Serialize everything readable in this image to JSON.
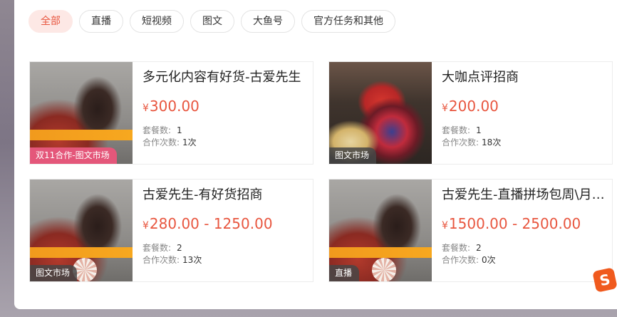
{
  "tabs": [
    {
      "label": "全部",
      "active": true
    },
    {
      "label": "直播"
    },
    {
      "label": "短视频"
    },
    {
      "label": "图文"
    },
    {
      "label": "大鱼号"
    },
    {
      "label": "官方任务和其他"
    }
  ],
  "labels": {
    "currency": "¥",
    "package_count": "套餐数:",
    "coop_count": "合作次数:"
  },
  "cards": [
    {
      "title": "多元化内容有好货-古爱先生",
      "price": "300.00",
      "packages": "1",
      "coops": "1次",
      "badge": "双11合作-图文市场",
      "thumb": "hand-photo"
    },
    {
      "title": "大咖点评招商",
      "price": "200.00",
      "packages": "1",
      "coops": "18次",
      "badge": "图文市场",
      "thumb": "mask-photo"
    },
    {
      "title": "古爱先生-有好货招商",
      "price": "280.00 - 1250.00",
      "packages": "2",
      "coops": "13次",
      "badge": "图文市场",
      "thumb": "hand-photo"
    },
    {
      "title": "古爱先生-直播拼场包周\\月套...",
      "price": "1500.00 - 2500.00",
      "packages": "2",
      "coops": "0次",
      "badge": "直播",
      "thumb": "hand-photo"
    }
  ],
  "floating": {
    "sogou_icon_glyph": "S"
  },
  "colors": {
    "accent": "#e8563f",
    "active_tab_bg": "#fde8e5",
    "badge_pink": "#e4577a"
  }
}
